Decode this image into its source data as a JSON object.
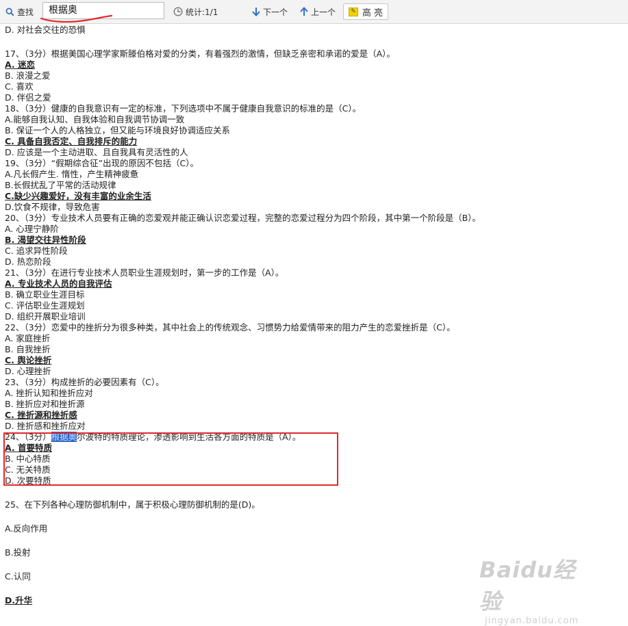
{
  "toolbar": {
    "find_label": "查找",
    "search_value": "根据奥",
    "stats_label": "统计:1/1",
    "next_label": "下一个",
    "prev_label": "上一个",
    "highlight_label": "高 亮"
  },
  "document": {
    "lines": [
      {
        "text": "D. 对社会交往的恐惧",
        "style": "normal"
      },
      {
        "text": "",
        "style": "gap"
      },
      {
        "text": "17、（3分）根据美国心理学家斯滕伯格对爱的分类，有着强烈的激情，但缺乏亲密和承诺的爱是（A）。",
        "style": "normal"
      },
      {
        "text": "A. 迷恋",
        "style": "ans"
      },
      {
        "text": "B. 浪漫之爱",
        "style": "normal"
      },
      {
        "text": "C. 喜欢",
        "style": "normal"
      },
      {
        "text": "D. 伴侣之爱",
        "style": "normal"
      },
      {
        "text": "18、（3分）健康的自我意识有一定的标准，下列选项中不属于健康自我意识的标准的是（C）。",
        "style": "normal"
      },
      {
        "text": " A.能够自我认知、自我体验和自我调节协调一致",
        "style": "normal"
      },
      {
        "text": "B. 保证一个人的人格独立，但又能与环境良好协调适应关系",
        "style": "normal"
      },
      {
        "text": "C. 具备自我否定、自我排斥的能力",
        "style": "ans"
      },
      {
        "text": "D. 应该是一个主动进取、且自我具有灵活性的人",
        "style": "normal"
      },
      {
        "text": "19、（3分）“假期综合征”出现的原因不包括（C）。",
        "style": "normal"
      },
      {
        "text": "A.凡长假产生. 惰性，产生精神疲惫",
        "style": "normal"
      },
      {
        "text": "B.长假扰乱了平常的活动规律",
        "style": "normal"
      },
      {
        "text": "C.缺少兴趣爱好，没有丰富的业余生活",
        "style": "ans"
      },
      {
        "text": "D.饮食不规律，导致危害",
        "style": "normal"
      },
      {
        "text": "20、（3分）专业技术人员要有正确的恋爱观并能正确认识恋爱过程，完整的恋爱过程分为四个阶段，其中第一个阶段是（B）。",
        "style": "normal"
      },
      {
        "text": "A. 心理宁静阶",
        "style": "normal"
      },
      {
        "text": "B. 渴望交往异性阶段",
        "style": "ans"
      },
      {
        "text": "C. 追求异性阶段",
        "style": "normal"
      },
      {
        "text": "D. 热恋阶段",
        "style": "normal"
      },
      {
        "text": "21、（3分）在进行专业技术人员职业生涯规划时，第一步的工作是（A）。",
        "style": "normal"
      },
      {
        "text": "A. 专业技术人员的自我评估",
        "style": "ans"
      },
      {
        "text": "B. 确立职业生涯目标",
        "style": "normal"
      },
      {
        "text": "C. 评估职业生涯规划",
        "style": "normal"
      },
      {
        "text": "D. 组织开展职业培训",
        "style": "normal"
      },
      {
        "text": "22、（3分）恋爱中的挫折分为很多种类，其中社会上的传统观念、习惯势力给爱情带来的阻力产生的恋爱挫折是（C）。",
        "style": "normal"
      },
      {
        "text": "A. 家庭挫折",
        "style": "normal"
      },
      {
        "text": "B. 自我挫折",
        "style": "normal"
      },
      {
        "text": "C. 舆论挫折",
        "style": "ans"
      },
      {
        "text": "D. 心理挫折",
        "style": "normal"
      },
      {
        "text": "23、（3分）构成挫折的必要因素有（C）。",
        "style": "normal"
      },
      {
        "text": "A. 挫折认知和挫折应对",
        "style": "normal"
      },
      {
        "text": "B. 挫折应对和挫折源",
        "style": "normal"
      },
      {
        "text": "C. 挫折源和挫折感",
        "style": "ans"
      },
      {
        "text": "D. 挫折感和挫折应对",
        "style": "normal"
      },
      {
        "pre": "24、（3分）",
        "hit": "根据奥",
        "post": "尔波特的特质理论，渗透影响到生活各方面的特质是（A）。",
        "style": "normal"
      },
      {
        "text": "A. 首要特质",
        "style": "ans"
      },
      {
        "text": "B. 中心特质",
        "style": "normal"
      },
      {
        "text": "C. 无关特质",
        "style": "normal"
      },
      {
        "text": "D. 次要特质",
        "style": "normal"
      },
      {
        "text": "",
        "style": "gap"
      },
      {
        "text": "25、在下列各种心理防御机制中，属于积极心理防御机制的是(D)。",
        "style": "tall"
      },
      {
        "text": "A.反向作用",
        "style": "tall"
      },
      {
        "text": "B.投射",
        "style": "tall"
      },
      {
        "text": "C.认同",
        "style": "tall"
      },
      {
        "text": "D.升华",
        "style": "tall-ans"
      }
    ]
  },
  "watermark": {
    "brand": "Baidu经验",
    "url": "jingyan.baidu.com"
  },
  "colors": {
    "annotation_box": "#e2272a",
    "search_hit": "#2a66c8",
    "squiggle": "#e2272a"
  }
}
